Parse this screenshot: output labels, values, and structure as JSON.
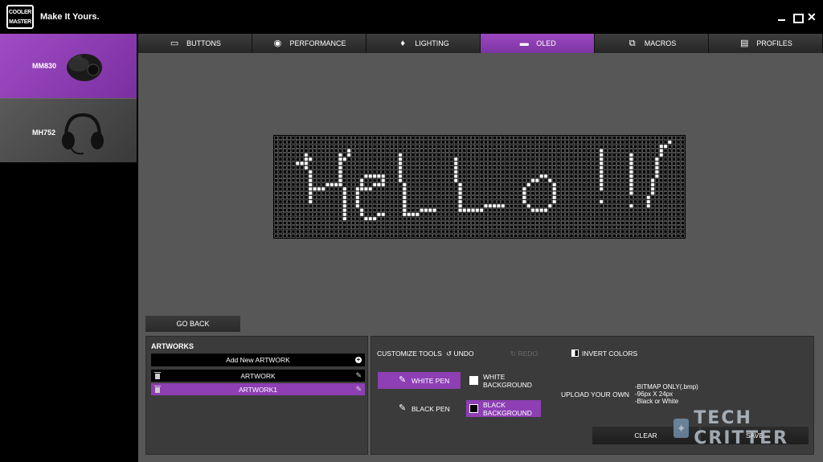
{
  "header": {
    "logo_text": "COOLER MASTER",
    "tagline": "Make It Yours."
  },
  "devices": [
    {
      "name": "MM830",
      "selected": true,
      "icon": "mouse-icon"
    },
    {
      "name": "MH752",
      "selected": false,
      "icon": "headset-icon"
    }
  ],
  "tabs": [
    {
      "label": "BUTTONS",
      "icon": "keyboard-icon",
      "active": false
    },
    {
      "label": "PERFORMANCE",
      "icon": "gauge-icon",
      "active": false
    },
    {
      "label": "LIGHTING",
      "icon": "bulb-icon",
      "active": false
    },
    {
      "label": "OLED",
      "icon": "oled-icon",
      "active": true
    },
    {
      "label": "MACROS",
      "icon": "macro-icon",
      "active": false
    },
    {
      "label": "PROFILES",
      "icon": "folder-icon",
      "active": false
    }
  ],
  "oled": {
    "text": "HeLLo!!/",
    "grid": "96px X 24px"
  },
  "go_back": "GO BACK",
  "artworks": {
    "title": "ARTWORKS",
    "add_label": "Add New ARTWORK",
    "items": [
      {
        "label": "ARTWORK",
        "selected": false
      },
      {
        "label": "ARTWORK1",
        "selected": true
      }
    ]
  },
  "tools": {
    "title": "CUSTOMIZE TOOLS",
    "undo": "UNDO",
    "redo": "REDO",
    "invert": "INVERT COLORS",
    "white_pen": "WHITE PEN",
    "black_pen": "BLACK PEN",
    "white_background": "WHITE BACKGROUND",
    "black_background": "BLACK BACKGROUND",
    "upload_label": "UPLOAD YOUR OWN",
    "upload_note_1": "-BITMAP ONLY(.bmp)",
    "upload_note_2": "-96px X 24px",
    "upload_note_3": "-Black or White",
    "clear": "CLEAR",
    "save": "SAVE"
  },
  "watermark": "TECH CRITTER",
  "colors": {
    "accent": "#8d3fb3",
    "panel": "#3b3b3b",
    "main_bg": "#575757"
  }
}
